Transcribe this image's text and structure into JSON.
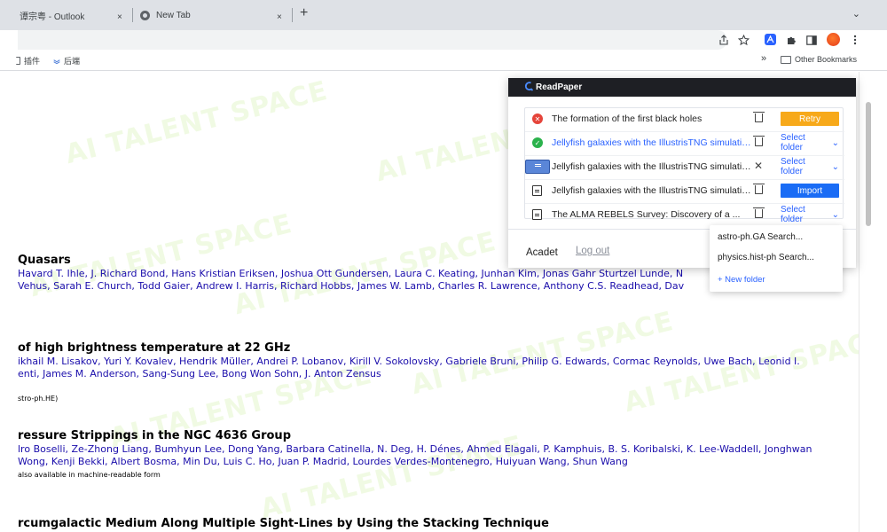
{
  "browser": {
    "tabs": [
      {
        "title": "谭宗粤 - Outlook",
        "close": "×"
      },
      {
        "title": "New Tab",
        "close": "×"
      }
    ],
    "new_tab": "+",
    "tab_menu": "⌄",
    "toolbar_icons": [
      "share-icon",
      "star-icon",
      "readpaper-extension-icon",
      "puzzle-icon",
      "sidepanel-icon",
      "profile-avatar",
      "menu-icon"
    ],
    "bookmarks": {
      "items": [
        {
          "label": "插件"
        },
        {
          "label": "后端"
        }
      ],
      "overflow": "»",
      "other": "Other Bookmarks"
    }
  },
  "page": {
    "papers": [
      {
        "title": " Quasars",
        "authors_line1": "Havard T. Ihle, J. Richard Bond, Hans Kristian Eriksen, Joshua Ott Gundersen, Laura C. Keating, Junhan Kim, Jonas Gahr Sturtzel Lunde, N",
        "authors_line2": "Vehus, Sarah E. Church, Todd Gaier, Andrew I. Harris, Richard Hobbs, James W. Lamb, Charles R. Lawrence, Anthony C.S. Readhead, Dav"
      },
      {
        "title": "of high brightness temperature at 22 GHz",
        "authors_line1": "ikhail M. Lisakov, Yuri Y. Kovalev, Hendrik Müller, Andrei P. Lobanov, Kirill V. Sokolovsky, Gabriele Bruni, Philip G. Edwards, Cormac Reynolds, Uwe Bach, Leonid I.",
        "authors_line2": "enti, James M. Anderson, Sang-Sung Lee, Bong Won Sohn, J. Anton Zensus",
        "note": "stro-ph.HE)"
      },
      {
        "title": "ressure Strippings in the NGC 4636 Group",
        "authors_line1": "lro Boselli, Ze-Zhong Liang, Bumhyun Lee, Dong Yang, Barbara Catinella, N. Deg, H. Dénes, Ahmed Elagali, P. Kamphuis, B. S. Koribalski, K. Lee-Waddell, Jonghwan",
        "authors_line2": "Wong, Kenji Bekki, Albert Bosma, Min Du, Luis C. Ho, Juan P. Madrid, Lourdes Verdes-Montenegro, Huiyuan Wang, Shun Wang",
        "note": "also available in machine-readable form"
      },
      {
        "title": "rcumgalactic Medium Along Multiple Sight-Lines by Using the Stacking Technique"
      }
    ],
    "watermark": "AI TALENT SPACE"
  },
  "readpaper": {
    "header": "ReadPaper",
    "items": [
      {
        "title": "The formation of the first black holes",
        "status": "error",
        "action": "Retry"
      },
      {
        "title": "Jellyfish galaxies with the IllustrisTNG simulations",
        "status": "success",
        "action": "Select folder"
      },
      {
        "title": "Jellyfish galaxies with the IllustrisTNG simulations",
        "status": "selected",
        "action": "Select folder"
      },
      {
        "title": "Jellyfish galaxies with the IllustrisTNG simulations",
        "status": "file",
        "action": "Import"
      },
      {
        "title": "The ALMA REBELS Survey: Discovery of a ...",
        "status": "file",
        "action": "Select folder"
      }
    ],
    "user": "Acadet",
    "logout": "Log out",
    "folder_menu": {
      "items": [
        "astro-ph.GA Search...",
        "physics.hist-ph Search..."
      ],
      "new_folder": "+ New folder"
    }
  },
  "colors": {
    "accent": "#2a62ff",
    "retry": "#f7a91a",
    "import": "#1a6cf5",
    "error": "#e5443a",
    "success": "#2bb24c",
    "author_link": "#1a0dab"
  }
}
